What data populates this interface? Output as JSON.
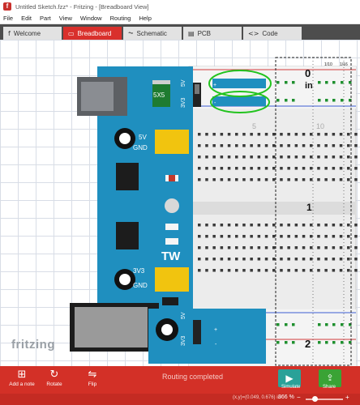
{
  "window": {
    "title": "Untitled Sketch.fzz* - Fritzing - [Breadboard View]"
  },
  "menu": [
    "File",
    "Edit",
    "Part",
    "View",
    "Window",
    "Routing",
    "Help"
  ],
  "tabs": [
    {
      "label": "Welcome",
      "icon": "f"
    },
    {
      "label": "Breadboard",
      "icon": "▭"
    },
    {
      "label": "Schematic",
      "icon": "⏦"
    },
    {
      "label": "PCB",
      "icon": "▤"
    },
    {
      "label": "Code",
      "icon": "<>"
    }
  ],
  "watermark": "fritzing",
  "board": {
    "label_5x5": "5X5",
    "v5": "5V",
    "v3": "3V3",
    "gnd": "GND",
    "tw": "TW"
  },
  "breadboard": {
    "rail_plus": "+",
    "rail_minus": "-",
    "row_0": "0",
    "unit": "in",
    "scale_a": "1/10",
    "scale_b": "1/16",
    "ruler_5": "5",
    "ruler_10": "10",
    "ruler_1": "1",
    "ruler_2": "2"
  },
  "toolbar": {
    "add_note": "Add a note",
    "rotate": "Rotate",
    "flip": "Flip",
    "simulate": "Simulate",
    "share": "Share"
  },
  "status": {
    "message": "Routing completed",
    "coords": "(x,y)=(0.049, 0.676) in",
    "zoom": "366 %"
  },
  "colors": {
    "accent": "#d33027",
    "board": "#1f8fbf",
    "header": "#f1c40f",
    "annotation": "#22c31e"
  }
}
